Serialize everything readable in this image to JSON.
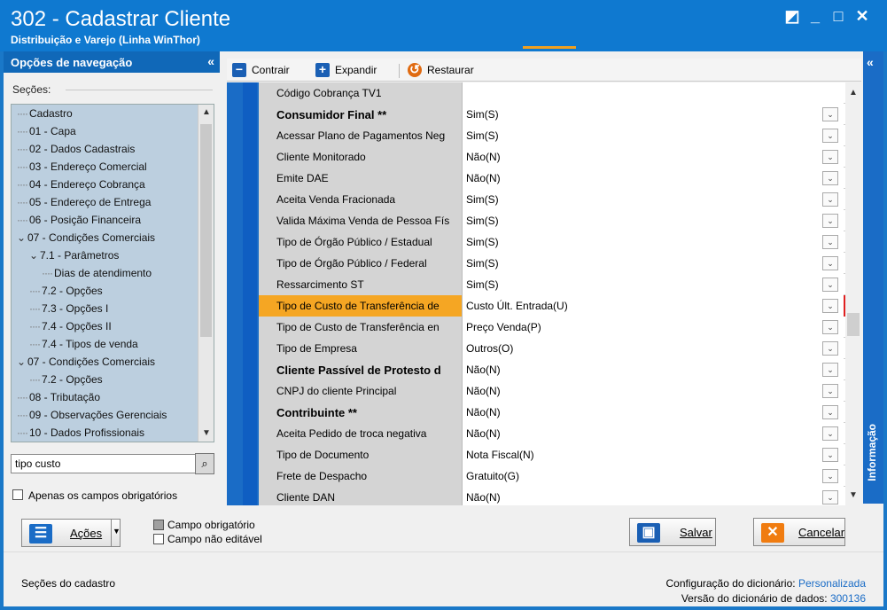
{
  "window": {
    "title": "302 - Cadastrar Cliente",
    "subtitle": "Distribuição e Varejo (Linha WinThor)"
  },
  "nav": {
    "header": "Opções de navegação",
    "collapse": "«",
    "sections_label": "Seções:",
    "tree": [
      {
        "label": "Cadastro"
      },
      {
        "label": "01 - Capa"
      },
      {
        "label": "02 - Dados Cadastrais"
      },
      {
        "label": "03 - Endereço Comercial"
      },
      {
        "label": "04 - Endereço Cobrança"
      },
      {
        "label": "05 - Endereço de Entrega"
      },
      {
        "label": "06 - Posição Financeira"
      },
      {
        "label": "07 - Condições Comerciais",
        "expanded": true
      },
      {
        "label": "7.1 - Parâmetros",
        "expanded": true
      },
      {
        "label": "Dias de atendimento"
      },
      {
        "label": "7.2 - Opções"
      },
      {
        "label": "7.3 - Opções I"
      },
      {
        "label": "7.4 - Opções II"
      },
      {
        "label": "7.4 - Tipos de venda"
      },
      {
        "label": "07 - Condições Comerciais",
        "expanded": true
      },
      {
        "label": "7.2 - Opções"
      },
      {
        "label": "08 - Tributação"
      },
      {
        "label": "09 - Observações Gerenciais"
      },
      {
        "label": "10 - Dados Profissionais"
      }
    ],
    "search_value": "tipo custo",
    "only_required_label": "Apenas os campos obrigatórios"
  },
  "toolbar": {
    "collapse_label": "Contrair",
    "expand_label": "Expandir",
    "restore_label": "Restaurar"
  },
  "grid": {
    "rows": [
      {
        "label": "Código Cobrança TV1",
        "value": "",
        "bold": false,
        "dropdown": false
      },
      {
        "label": "Consumidor Final **",
        "value": "Sim(S)",
        "bold": true,
        "dropdown": true
      },
      {
        "label": "Acessar Plano de Pagamentos Neg",
        "value": "Sim(S)",
        "bold": false,
        "dropdown": true
      },
      {
        "label": "Cliente Monitorado",
        "value": "Não(N)",
        "bold": false,
        "dropdown": true
      },
      {
        "label": "Emite DAE",
        "value": "Não(N)",
        "bold": false,
        "dropdown": true
      },
      {
        "label": "Aceita Venda Fracionada",
        "value": "Sim(S)",
        "bold": false,
        "dropdown": true
      },
      {
        "label": "Valida Máxima Venda de Pessoa Fís",
        "value": "Sim(S)",
        "bold": false,
        "dropdown": true
      },
      {
        "label": "Tipo de Órgão Público / Estadual",
        "value": "Sim(S)",
        "bold": false,
        "dropdown": true
      },
      {
        "label": "Tipo de Órgão Público / Federal",
        "value": "Sim(S)",
        "bold": false,
        "dropdown": true
      },
      {
        "label": "Ressarcimento ST",
        "value": "Sim(S)",
        "bold": false,
        "dropdown": true
      },
      {
        "label": "Tipo de Custo de Transferência de",
        "value": "Custo Últ. Entrada(U)",
        "bold": false,
        "dropdown": true,
        "selected": true
      },
      {
        "label": "Tipo de Custo de Transferência en",
        "value": "Preço Venda(P)",
        "bold": false,
        "dropdown": true
      },
      {
        "label": "Tipo de Empresa",
        "value": "Outros(O)",
        "bold": false,
        "dropdown": true
      },
      {
        "label": "Cliente Passível de Protesto d",
        "value": "Não(N)",
        "bold": true,
        "dropdown": true
      },
      {
        "label": "CNPJ do cliente Principal",
        "value": "Não(N)",
        "bold": false,
        "dropdown": true
      },
      {
        "label": "Contribuinte **",
        "value": "Não(N)",
        "bold": true,
        "dropdown": true
      },
      {
        "label": "Aceita Pedido de troca negativa",
        "value": "Não(N)",
        "bold": false,
        "dropdown": true
      },
      {
        "label": "Tipo de Documento",
        "value": "Nota Fiscal(N)",
        "bold": false,
        "dropdown": true
      },
      {
        "label": "Frete de Despacho",
        "value": "Gratuito(G)",
        "bold": false,
        "dropdown": true
      },
      {
        "label": "Cliente DAN",
        "value": "Não(N)",
        "bold": false,
        "dropdown": true
      }
    ]
  },
  "info_panel": {
    "label": "Informação",
    "collapse": "«"
  },
  "footer": {
    "actions_label": "Ações",
    "legend_required": "Campo obrigatório",
    "legend_readonly": "Campo não editável",
    "save_label": "Salvar",
    "cancel_label": "Cancelar",
    "status_left": "Seções do cadastro",
    "dict_config_label": "Configuração do dicionário:",
    "dict_config_value": "Personalizada",
    "dict_version_label": "Versão do dicionário de dados:",
    "dict_version_value": "300136"
  },
  "colors": {
    "title_bar": "#0f79d0",
    "nav_tree_bg": "#bccfdf",
    "selected_row": "#f5a623",
    "selected_outline": "#e02020",
    "link": "#1a6cc6"
  }
}
